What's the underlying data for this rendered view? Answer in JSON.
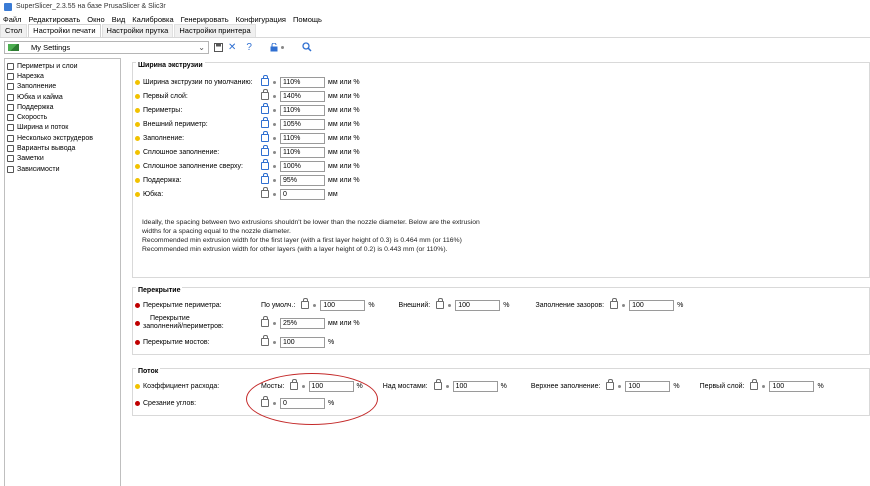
{
  "window": {
    "title": "SuperSlicer_2.3.55 на базе PrusaSlicer & Slic3r"
  },
  "menu": [
    "Файл",
    "Редактировать",
    "Окно",
    "Вид",
    "Калибровка",
    "Генерировать",
    "Конфигурация",
    "Помощь"
  ],
  "tabs": [
    "Стол",
    "Настройки печати",
    "Настройки прутка",
    "Настройки принтера"
  ],
  "active_tab": 1,
  "toolbar": {
    "preset": "My Settings",
    "help": "?"
  },
  "sidebar": [
    "Периметры и слои",
    "Нарезка",
    "Заполнение",
    "Юбка и кайма",
    "Поддержка",
    "Скорость",
    "Ширина и поток",
    "Несколько экструдеров",
    "Варианты вывода",
    "Заметки",
    "Зависимости"
  ],
  "extrusion": {
    "title": "Ширина экструзии",
    "rows": [
      {
        "label": "Ширина экструзии по умолчанию:",
        "value": "110%",
        "unit": "мм или %"
      },
      {
        "label": "Первый слой:",
        "value": "140%",
        "unit": "мм или %"
      },
      {
        "label": "Периметры:",
        "value": "110%",
        "unit": "мм или %"
      },
      {
        "label": "Внешний периметр:",
        "value": "105%",
        "unit": "мм или %"
      },
      {
        "label": "Заполнение:",
        "value": "110%",
        "unit": "мм или %"
      },
      {
        "label": "Сплошное заполнение:",
        "value": "110%",
        "unit": "мм или %"
      },
      {
        "label": "Сплошное заполнение сверху:",
        "value": "100%",
        "unit": "мм или %"
      },
      {
        "label": "Поддержка:",
        "value": "95%",
        "unit": "мм или %"
      },
      {
        "label": "Юбка:",
        "value": "0",
        "unit": "мм"
      }
    ],
    "note": [
      "Ideally, the spacing between two extrusions shouldn't be lower than the nozzle diameter. Below are the extrusion",
      "widths for a spacing equal to the nozzle diameter.",
      "Recommended min extrusion width for the first layer (with a first layer height of 0.3) is 0.464 mm (or 116%)",
      "Recommended min extrusion width for other layers (with a layer height of 0.2) is 0.443 mm (or 110%)."
    ]
  },
  "overlap": {
    "title": "Перекрытие",
    "perimeter_label": "Перекрытие периметра:",
    "perimeter_sub": [
      {
        "label": "По умолч.:",
        "value": "100",
        "unit": "%"
      },
      {
        "label": "Внешний:",
        "value": "100",
        "unit": "%"
      },
      {
        "label": "Заполнение зазоров:",
        "value": "100",
        "unit": "%"
      }
    ],
    "infill_label_1": "Перекрытие",
    "infill_label_2": "заполнений/периметров:",
    "infill_value": "25%",
    "infill_unit": "мм или %",
    "bridges_label": "Перекрытие мостов:",
    "bridges_value": "100",
    "bridges_unit": "%"
  },
  "flow": {
    "title": "Поток",
    "ratio_label": "Коэффициент расхода:",
    "ratio_sub": [
      {
        "label": "Мосты:",
        "value": "100",
        "unit": "%"
      },
      {
        "label": "Над мостами:",
        "value": "100",
        "unit": "%"
      },
      {
        "label": "Верхнее заполнение:",
        "value": "100",
        "unit": "%"
      },
      {
        "label": "Первый слой:",
        "value": "100",
        "unit": "%"
      }
    ],
    "corner_label": "Срезание углов:",
    "corner_value": "0",
    "corner_unit": "%"
  },
  "colors": {
    "accent": "#2f6fd1",
    "dot_yellow": "#f2c200",
    "dot_red": "#c00000",
    "annotation": "#c42a2a"
  }
}
